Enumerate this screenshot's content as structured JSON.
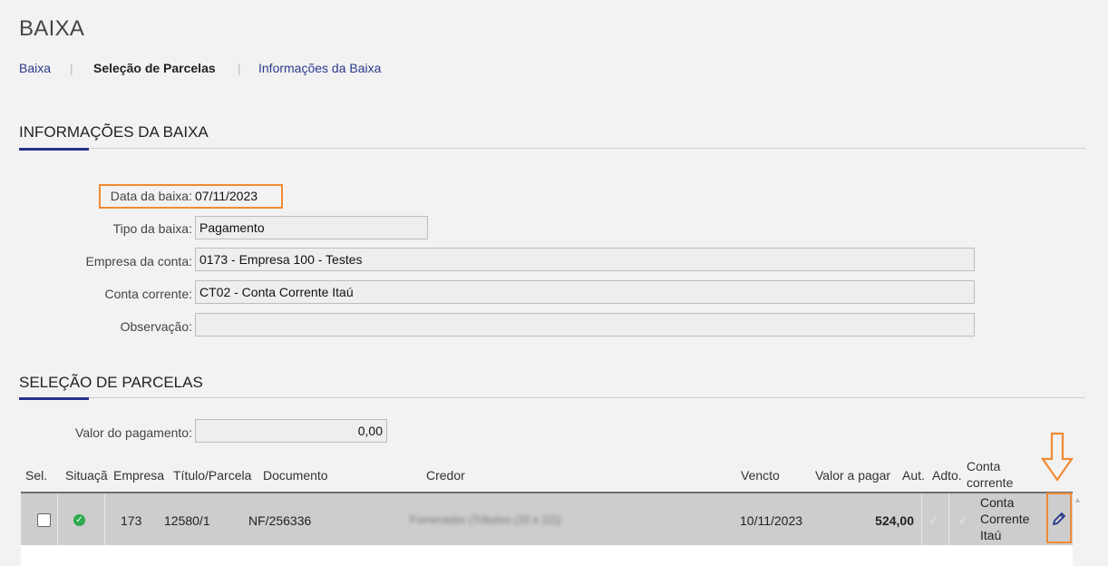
{
  "page": {
    "title": "BAIXA"
  },
  "breadcrumb": {
    "items": [
      {
        "label": "Baixa"
      },
      {
        "label": "Seleção de Parcelas"
      },
      {
        "label": "Informações da Baixa"
      }
    ]
  },
  "info_section": {
    "title": "INFORMAÇÕES DA BAIXA",
    "fields": [
      {
        "label": "Data da baixa:",
        "value": "07/11/2023"
      },
      {
        "label": "Tipo da baixa:",
        "value": "Pagamento"
      },
      {
        "label": "Empresa da conta:",
        "value": "0173 - Empresa 100 - Testes"
      },
      {
        "label": "Conta corrente:",
        "value": "CT02 - Conta Corrente Itaú"
      },
      {
        "label": "Observação:",
        "value": ""
      }
    ]
  },
  "parcelas_section": {
    "title": "SELEÇÃO DE PARCELAS",
    "valor_label": "Valor do pagamento:",
    "valor_value": "0,00",
    "columns": [
      "Sel.",
      "Situaçã",
      "Empresa",
      "Título/Parcela",
      "Documento",
      "Credor",
      "Vencto",
      "Valor a pagar",
      "Aut.",
      "Adto.",
      "Conta",
      "corrente"
    ],
    "rows": [
      {
        "empresa": "173",
        "titulo": "12580/1",
        "documento": "NF/256336",
        "credor": "Fornecedor (Tributos (33 e 22))",
        "vencto": "10/11/2023",
        "valor": "524,00",
        "conta_lines": [
          "Conta",
          "Corrente",
          "Itaú"
        ]
      }
    ]
  },
  "colors": {
    "accent": "#27348b",
    "highlight": "#f08a34",
    "status_ok": "#2eaa4f"
  },
  "icons": {
    "status": "check-circle-icon",
    "edit": "pencil-icon",
    "annotation": "arrow-down-icon"
  }
}
